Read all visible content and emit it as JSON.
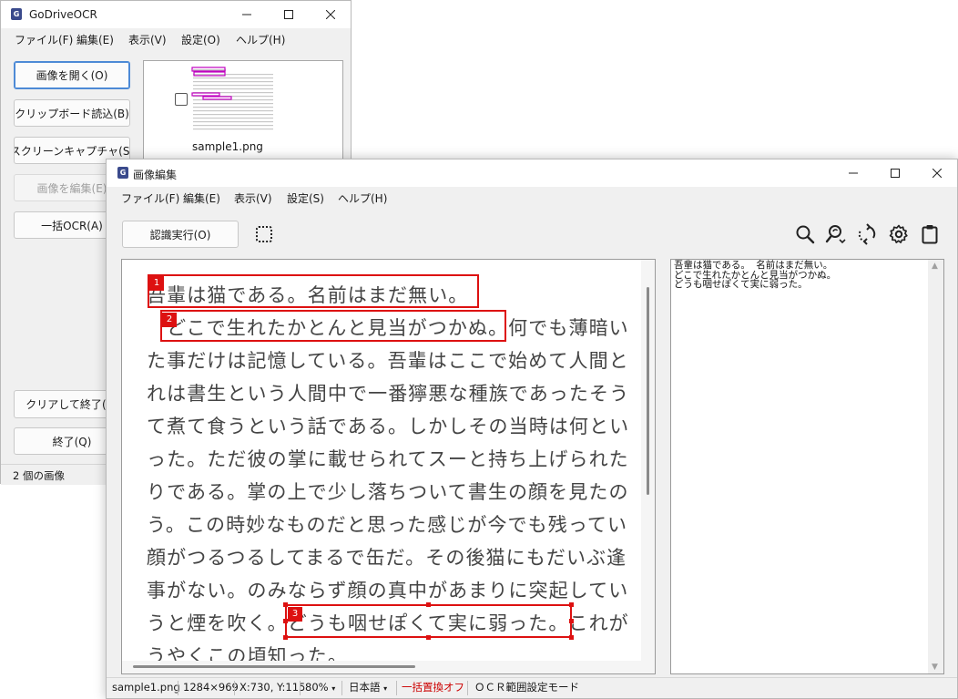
{
  "main_window": {
    "title": "GoDriveOCR",
    "app_icon_letter": "G",
    "menu": [
      "ファイル(F)",
      "編集(E)",
      "表示(V)",
      "設定(O)",
      "ヘルプ(H)"
    ],
    "buttons": {
      "open_image": "画像を開く(O)",
      "clipboard": "クリップボード読込(B)",
      "screen_capture": "スクリーンキャプチャ(S)",
      "edit_image": "画像を編集(E)",
      "batch_ocr": "一括OCR(A)",
      "clear_exit": "クリアして終了(C)",
      "exit": "終了(Q)"
    },
    "thumbnail": {
      "filename": "sample1.png",
      "checked": false
    },
    "status": "2 個の画像"
  },
  "editor_window": {
    "title": "画像編集",
    "app_icon_letter": "G",
    "menu": [
      "ファイル(F)",
      "編集(E)",
      "表示(V)",
      "設定(S)",
      "ヘルプ(H)"
    ],
    "toolbar": {
      "recognize": "認識実行(O)",
      "icons": [
        "select-region-icon",
        "search-icon",
        "find-replace-icon",
        "rotate-icon",
        "gear-icon",
        "clipboard-icon"
      ]
    },
    "document_lines": [
      "吾輩は猫である。名前はまだ無い。",
      "　どこで生れたかとんと見当がつかぬ。何でも薄暗い",
      "た事だけは記憶している。吾輩はここで始めて人間と",
      "れは書生という人間中で一番獰悪な種族であったそう",
      "て煮て食うという話である。しかしその当時は何とい",
      "った。ただ彼の掌に載せられてスーと持ち上げられた",
      "りである。掌の上で少し落ちついて書生の顔を見たの",
      "う。この時妙なものだと思った感じが今でも残ってい",
      "顔がつるつるしてまるで缶だ。その後猫にもだいぶ逢",
      "事がない。のみならず顔の真中があまりに突起してい",
      "うと煙を吹く。どうも咽せぽくて実に弱った。これが",
      "うやくこの頃知った。"
    ],
    "ocr_regions": [
      {
        "number": "1"
      },
      {
        "number": "2"
      },
      {
        "number": "3"
      }
    ],
    "ocr_text": "吾輩は猫である。 名前はまだ無い。\nどこで生れたかとんと見当がつかぬ。\nどうも咽せぽくて実に弱った。",
    "status": {
      "filename": "sample1.png",
      "dimensions": "1284×969",
      "coords": "X:730, Y:115",
      "zoom": "80%",
      "language": "日本語",
      "replace": "一括置換オフ",
      "mode": "ＯＣＲ範囲設定モード"
    },
    "colors": {
      "accent": "#dd1111",
      "replace_off": "#cc0000"
    }
  }
}
